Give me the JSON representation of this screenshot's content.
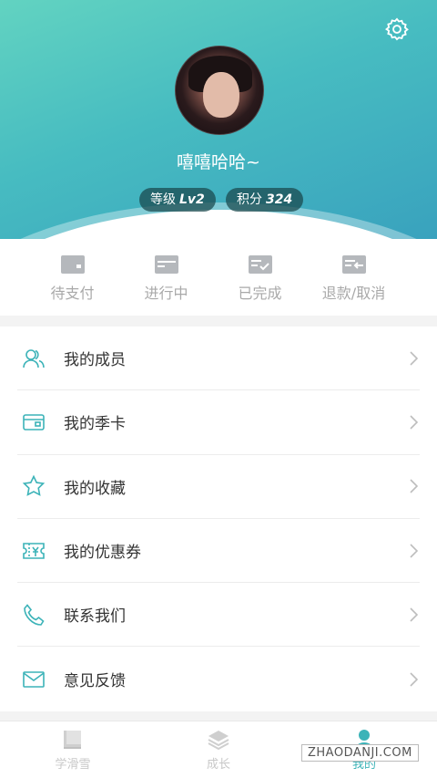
{
  "profile": {
    "username": "嘻嘻哈哈~",
    "level_label": "等级",
    "level_value": "Lv2",
    "points_label": "积分",
    "points_value": "324"
  },
  "orders": [
    {
      "label": "待支付",
      "icon": "card-icon"
    },
    {
      "label": "进行中",
      "icon": "in-progress-icon"
    },
    {
      "label": "已完成",
      "icon": "completed-icon"
    },
    {
      "label": "退款/取消",
      "icon": "refund-icon"
    }
  ],
  "menu": [
    {
      "label": "我的成员",
      "icon": "members-icon"
    },
    {
      "label": "我的季卡",
      "icon": "season-card-icon"
    },
    {
      "label": "我的收藏",
      "icon": "star-icon"
    },
    {
      "label": "我的优惠券",
      "icon": "coupon-icon"
    },
    {
      "label": "联系我们",
      "icon": "phone-icon"
    },
    {
      "label": "意见反馈",
      "icon": "mail-icon"
    }
  ],
  "tabs": [
    {
      "label": "学滑雪",
      "icon": "book-icon",
      "active": false
    },
    {
      "label": "成长",
      "icon": "layers-icon",
      "active": false
    },
    {
      "label": "我的",
      "icon": "person-icon",
      "active": true
    }
  ],
  "watermark": "ZHAODANJI.COM",
  "colors": {
    "accent": "#3cb3b8",
    "header_start": "#62d3c1",
    "header_end": "#39a2be"
  }
}
